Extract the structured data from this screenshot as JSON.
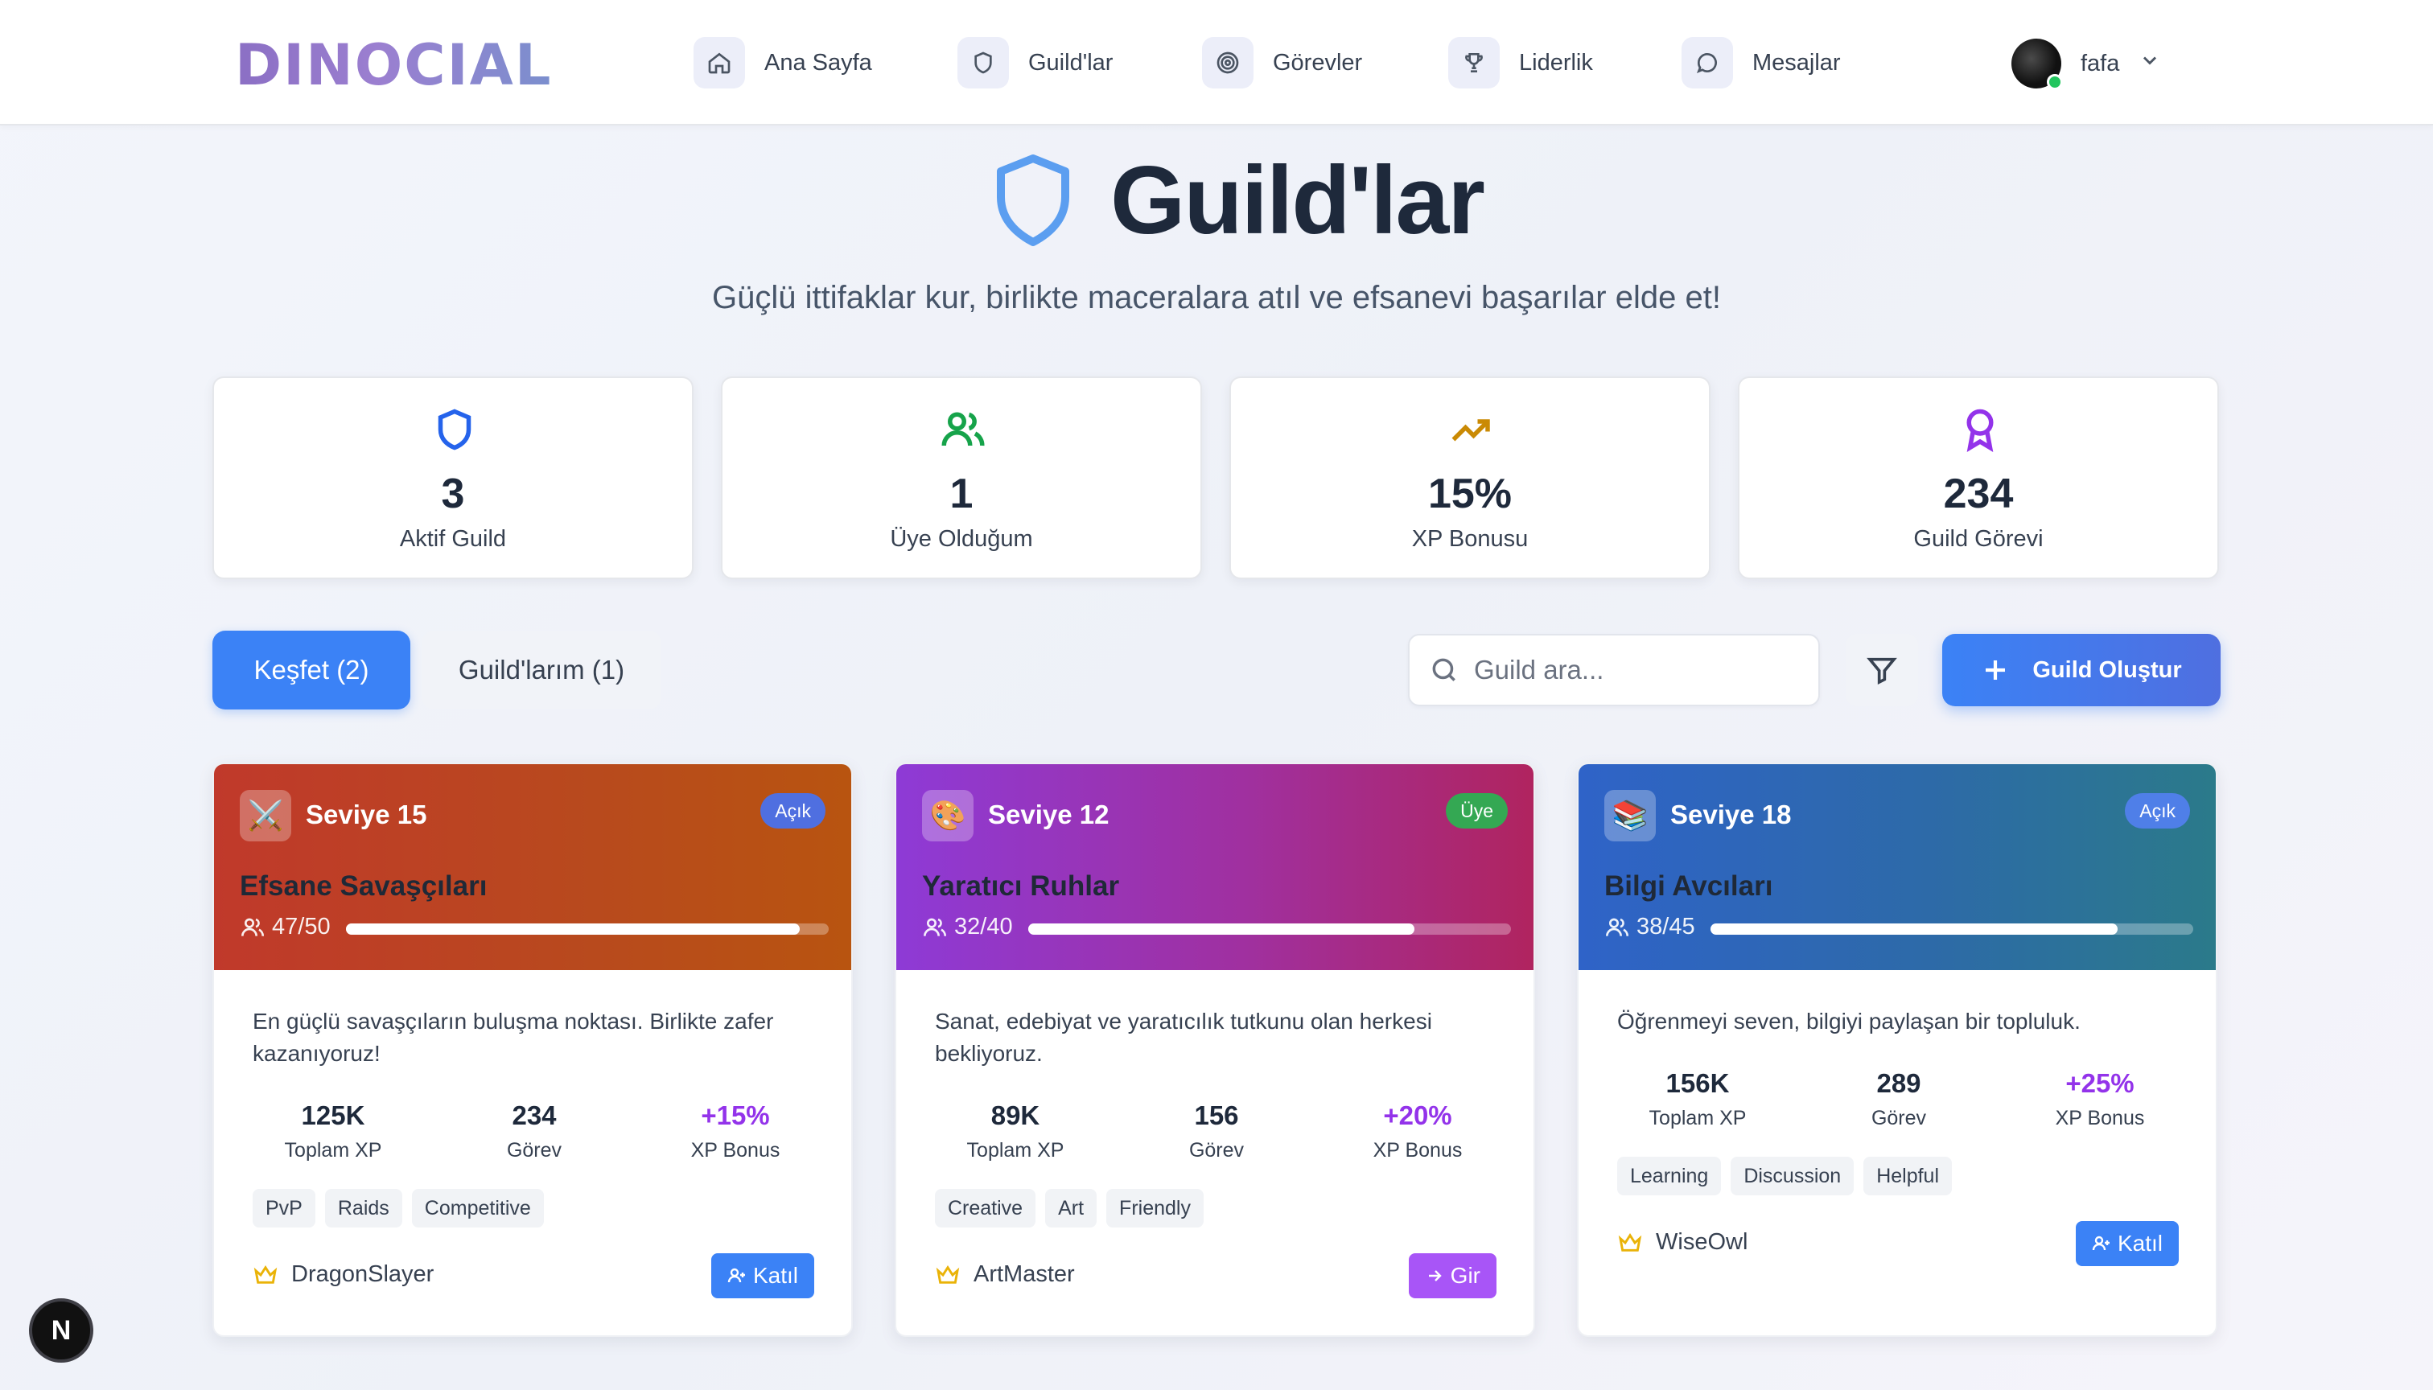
{
  "nav": {
    "logo": "DINOCIAL",
    "items": [
      {
        "label": "Ana Sayfa",
        "icon": "home-icon"
      },
      {
        "label": "Guild'lar",
        "icon": "shield-icon"
      },
      {
        "label": "Görevler",
        "icon": "target-icon"
      },
      {
        "label": "Liderlik",
        "icon": "trophy-icon"
      },
      {
        "label": "Mesajlar",
        "icon": "message-icon"
      }
    ],
    "user": {
      "name": "fafa",
      "status_color": "#22c55e"
    }
  },
  "hero": {
    "title": "Guild'lar",
    "subtitle": "Güçlü ittifaklar kur, birlikte maceralara atıl ve efsanevi başarılar elde et!"
  },
  "stats": [
    {
      "value": "3",
      "label": "Aktif Guild",
      "icon": "shield-icon",
      "color": "#2563eb"
    },
    {
      "value": "1",
      "label": "Üye Olduğum",
      "icon": "users-icon",
      "color": "#16a34a"
    },
    {
      "value": "15%",
      "label": "XP Bonusu",
      "icon": "trending-up-icon",
      "color": "#ca8a04"
    },
    {
      "value": "234",
      "label": "Guild Görevi",
      "icon": "award-icon",
      "color": "#9333ea"
    }
  ],
  "toolbar": {
    "tab_discover": "Keşfet (2)",
    "tab_mine": "Guild'larım (1)",
    "search_placeholder": "Guild ara...",
    "create_label": "Guild Oluştur"
  },
  "guilds": [
    {
      "emoji": "⚔️",
      "level": "Seviye 15",
      "badge": "Açık",
      "name": "Efsane Savaşçıları",
      "members": "47/50",
      "fill": 0.94,
      "description": "En güçlü savaşçıların buluşma noktası. Birlikte zafer kazanıyoruz!",
      "xp": "125K",
      "xp_label": "Toplam XP",
      "tasks": "234",
      "tasks_label": "Görev",
      "bonus": "+15%",
      "bonus_label": "XP Bonus",
      "tags": [
        "PvP",
        "Raids",
        "Competitive"
      ],
      "owner": "DragonSlayer",
      "action": "Katıl"
    },
    {
      "emoji": "🎨",
      "level": "Seviye 12",
      "badge": "Üye",
      "name": "Yaratıcı Ruhlar",
      "members": "32/40",
      "fill": 0.8,
      "description": "Sanat, edebiyat ve yaratıcılık tutkunu olan herkesi bekliyoruz.",
      "xp": "89K",
      "xp_label": "Toplam XP",
      "tasks": "156",
      "tasks_label": "Görev",
      "bonus": "+20%",
      "bonus_label": "XP Bonus",
      "tags": [
        "Creative",
        "Art",
        "Friendly"
      ],
      "owner": "ArtMaster",
      "action": "Gir"
    },
    {
      "emoji": "📚",
      "level": "Seviye 18",
      "badge": "Açık",
      "name": "Bilgi Avcıları",
      "members": "38/45",
      "fill": 0.844,
      "description": "Öğrenmeyi seven, bilgiyi paylaşan bir topluluk.",
      "xp": "156K",
      "xp_label": "Toplam XP",
      "tasks": "289",
      "tasks_label": "Görev",
      "bonus": "+25%",
      "bonus_label": "XP Bonus",
      "tags": [
        "Learning",
        "Discussion",
        "Helpful"
      ],
      "owner": "WiseOwl",
      "action": "Katıl"
    }
  ],
  "dev_badge": "N"
}
